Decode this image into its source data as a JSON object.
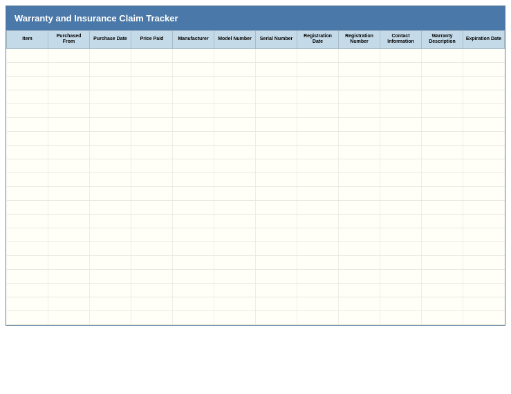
{
  "title": "Warranty and Insurance Claim Tracker",
  "columns": [
    "Item",
    "Purchased From",
    "Purchase Date",
    "Price Paid",
    "Manufacturer",
    "Model Number",
    "Serial Number",
    "Registration Date",
    "Registration Number",
    "Contact Information",
    "Warranty Description",
    "Expiration Date"
  ],
  "rows": [
    [
      "",
      "",
      "",
      "",
      "",
      "",
      "",
      "",
      "",
      "",
      "",
      ""
    ],
    [
      "",
      "",
      "",
      "",
      "",
      "",
      "",
      "",
      "",
      "",
      "",
      ""
    ],
    [
      "",
      "",
      "",
      "",
      "",
      "",
      "",
      "",
      "",
      "",
      "",
      ""
    ],
    [
      "",
      "",
      "",
      "",
      "",
      "",
      "",
      "",
      "",
      "",
      "",
      ""
    ],
    [
      "",
      "",
      "",
      "",
      "",
      "",
      "",
      "",
      "",
      "",
      "",
      ""
    ],
    [
      "",
      "",
      "",
      "",
      "",
      "",
      "",
      "",
      "",
      "",
      "",
      ""
    ],
    [
      "",
      "",
      "",
      "",
      "",
      "",
      "",
      "",
      "",
      "",
      "",
      ""
    ],
    [
      "",
      "",
      "",
      "",
      "",
      "",
      "",
      "",
      "",
      "",
      "",
      ""
    ],
    [
      "",
      "",
      "",
      "",
      "",
      "",
      "",
      "",
      "",
      "",
      "",
      ""
    ],
    [
      "",
      "",
      "",
      "",
      "",
      "",
      "",
      "",
      "",
      "",
      "",
      ""
    ],
    [
      "",
      "",
      "",
      "",
      "",
      "",
      "",
      "",
      "",
      "",
      "",
      ""
    ],
    [
      "",
      "",
      "",
      "",
      "",
      "",
      "",
      "",
      "",
      "",
      "",
      ""
    ],
    [
      "",
      "",
      "",
      "",
      "",
      "",
      "",
      "",
      "",
      "",
      "",
      ""
    ],
    [
      "",
      "",
      "",
      "",
      "",
      "",
      "",
      "",
      "",
      "",
      "",
      ""
    ],
    [
      "",
      "",
      "",
      "",
      "",
      "",
      "",
      "",
      "",
      "",
      "",
      ""
    ],
    [
      "",
      "",
      "",
      "",
      "",
      "",
      "",
      "",
      "",
      "",
      "",
      ""
    ],
    [
      "",
      "",
      "",
      "",
      "",
      "",
      "",
      "",
      "",
      "",
      "",
      ""
    ],
    [
      "",
      "",
      "",
      "",
      "",
      "",
      "",
      "",
      "",
      "",
      "",
      ""
    ],
    [
      "",
      "",
      "",
      "",
      "",
      "",
      "",
      "",
      "",
      "",
      "",
      ""
    ],
    [
      "",
      "",
      "",
      "",
      "",
      "",
      "",
      "",
      "",
      "",
      "",
      ""
    ]
  ]
}
